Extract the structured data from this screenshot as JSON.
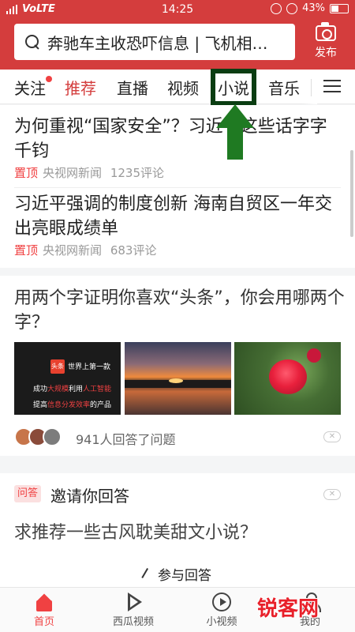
{
  "status": {
    "carrier": "VoLTE",
    "time": "14:25",
    "battery": "43%"
  },
  "search": {
    "query": "奔驰车主收恐吓信息 | 飞机相…"
  },
  "publish": {
    "label": "发布"
  },
  "tabs": [
    {
      "label": "关注"
    },
    {
      "label": "推荐"
    },
    {
      "label": "直播"
    },
    {
      "label": "视频"
    },
    {
      "label": "小说"
    },
    {
      "label": "音乐"
    }
  ],
  "news": [
    {
      "title": "为何重视“国家安全”？习近平这些话字字千钧",
      "tag": "置顶",
      "source": "央视网新闻",
      "comments": "1235评论"
    },
    {
      "title": "习近平强调的制度创新 海南自贸区一年交出亮眼成绩单",
      "tag": "置顶",
      "source": "央视网新闻",
      "comments": "683评论"
    }
  ],
  "question_card": {
    "title": "用两个字证明你喜欢“头条”，你会用哪两个字？",
    "thumb1": {
      "logo": "头条",
      "line1": "世界上第一款",
      "line2a": "成功",
      "line2b": "大规模",
      "line2c": "利用",
      "line2d": "人工智能",
      "line3a": "提高",
      "line3b": "信息分发效率",
      "line3c": "的产品"
    },
    "answered": "941人回答了问题",
    "dislike": "✕"
  },
  "invite_card": {
    "badge": "问答",
    "title": "邀请你回答",
    "question": "求推荐一些古风耽美甜文小说？",
    "action": "参与回答",
    "dislike": "✕"
  },
  "bottom_nav": [
    {
      "label": "首页"
    },
    {
      "label": "西瓜视频"
    },
    {
      "label": "小视频"
    },
    {
      "label": "我的"
    }
  ],
  "watermark": "锐客网",
  "colors": {
    "brand_red": "#d43d3d",
    "accent_red": "#f04142",
    "arrow_green": "#1f7a22",
    "box_green": "#0a3d12"
  }
}
